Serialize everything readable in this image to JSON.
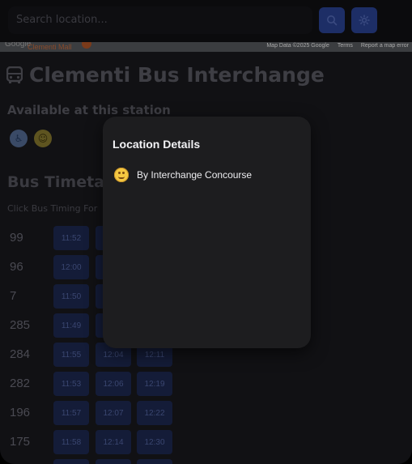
{
  "search": {
    "placeholder": "Search location..."
  },
  "map": {
    "brand": "Google",
    "place_label": "Clementi Mall",
    "attribution": "Map Data ©2025 Google",
    "terms": "Terms",
    "report": "Report a map error"
  },
  "station": {
    "title": "Clementi Bus Interchange",
    "available_heading": "Available at this station",
    "amenities": [
      "wheelchair-icon",
      "toilet-icon"
    ]
  },
  "timetable": {
    "heading": "Bus Timetab",
    "hint": "Click Bus Timing For",
    "rows": [
      {
        "route": "99",
        "times": [
          "11:52",
          "",
          ""
        ]
      },
      {
        "route": "96",
        "times": [
          "12:00",
          "",
          ""
        ]
      },
      {
        "route": "7",
        "times": [
          "11:50",
          "",
          ""
        ]
      },
      {
        "route": "285",
        "times": [
          "11:49",
          "",
          ""
        ]
      },
      {
        "route": "284",
        "times": [
          "11:55",
          "12:04",
          "12:11"
        ]
      },
      {
        "route": "282",
        "times": [
          "11:53",
          "12:06",
          "12:19"
        ]
      },
      {
        "route": "196",
        "times": [
          "11:57",
          "12:07",
          "12:22"
        ]
      },
      {
        "route": "175",
        "times": [
          "11:58",
          "12:14",
          "12:30"
        ]
      }
    ]
  },
  "modal": {
    "title": "Location Details",
    "item_icon": "face-icon",
    "item_text": "By Interchange Concourse"
  },
  "colors": {
    "accent_button": "#1d2e66",
    "modal_bg": "#1d1d1f",
    "time_button": "#141c38"
  }
}
